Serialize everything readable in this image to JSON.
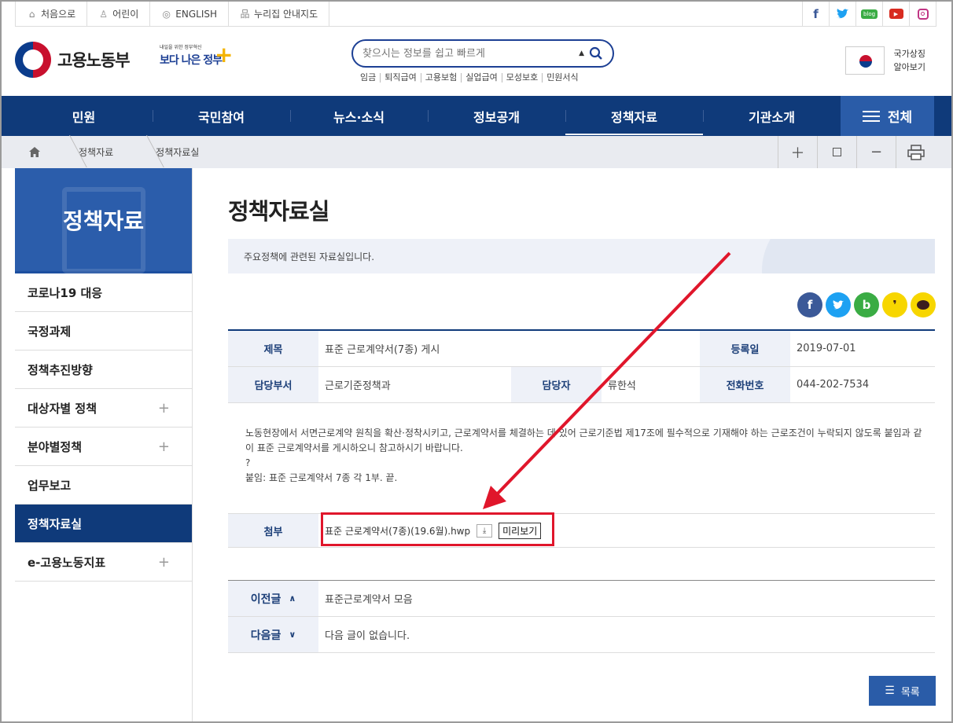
{
  "util": {
    "home": "처음으로",
    "kids": "어린이",
    "english": "ENGLISH",
    "sitemap": "누리집 안내지도"
  },
  "header": {
    "logo": "고용노동부",
    "better_small": "내일을 위한 정부혁신",
    "better_big": "보다 나은 정부",
    "search_placeholder": "찾으시는 정보를 쉽고 빠르게",
    "quick_links": [
      "임금",
      "퇴직급여",
      "고용보험",
      "실업급여",
      "모성보호",
      "민원서식"
    ],
    "symbol_line1": "국가상징",
    "symbol_line2": "알아보기"
  },
  "gnb": {
    "items": [
      "민원",
      "국민참여",
      "뉴스·소식",
      "정보공개",
      "정책자료",
      "기관소개"
    ],
    "all": "전체"
  },
  "breadcrumb": [
    "정책자료",
    "정책자료실"
  ],
  "sidebar": {
    "title": "정책자료",
    "items": [
      "코로나19 대응",
      "국정과제",
      "정책추진방향",
      "대상자별 정책",
      "분야별정책",
      "업무보고",
      "정책자료실",
      "e-고용노동지표"
    ]
  },
  "content": {
    "title": "정책자료실",
    "intro": "주요정책에 관련된 자료실입니다.",
    "labels": {
      "subject": "제목",
      "date": "등록일",
      "dept": "담당부서",
      "person": "담당자",
      "phone": "전화번호",
      "attach": "첨부",
      "prev": "이전글",
      "next": "다음글"
    },
    "subject": "표준 근로계약서(7종) 게시",
    "date": "2019-07-01",
    "dept": "근로기준정책과",
    "person": "류한석",
    "phone": "044-202-7534",
    "body1": "노동현장에서 서면근로계약 원칙을 확산·정착시키고, 근로계약서를 체결하는 데 있어 근로기준법 제17조에 필수적으로 기재해야 하는 근로조건이 누락되지 않도록 붙임과 같이 표준 근로계약서를 게시하오니 참고하시기 바랍니다.",
    "body2": "?",
    "body3": "붙임: 표준 근로계약서 7종 각 1부.  끝.",
    "attach_file": "표준 근로계약서(7종)(19.6월).hwp",
    "preview": "미리보기",
    "prev_title": "표준근로계약서 모음",
    "next_title": "다음 글이 없습니다.",
    "list": "목록"
  },
  "colors": {
    "navy": "#0f3a7a",
    "accent": "#2a5ca8",
    "highlight": "#e0162b"
  }
}
